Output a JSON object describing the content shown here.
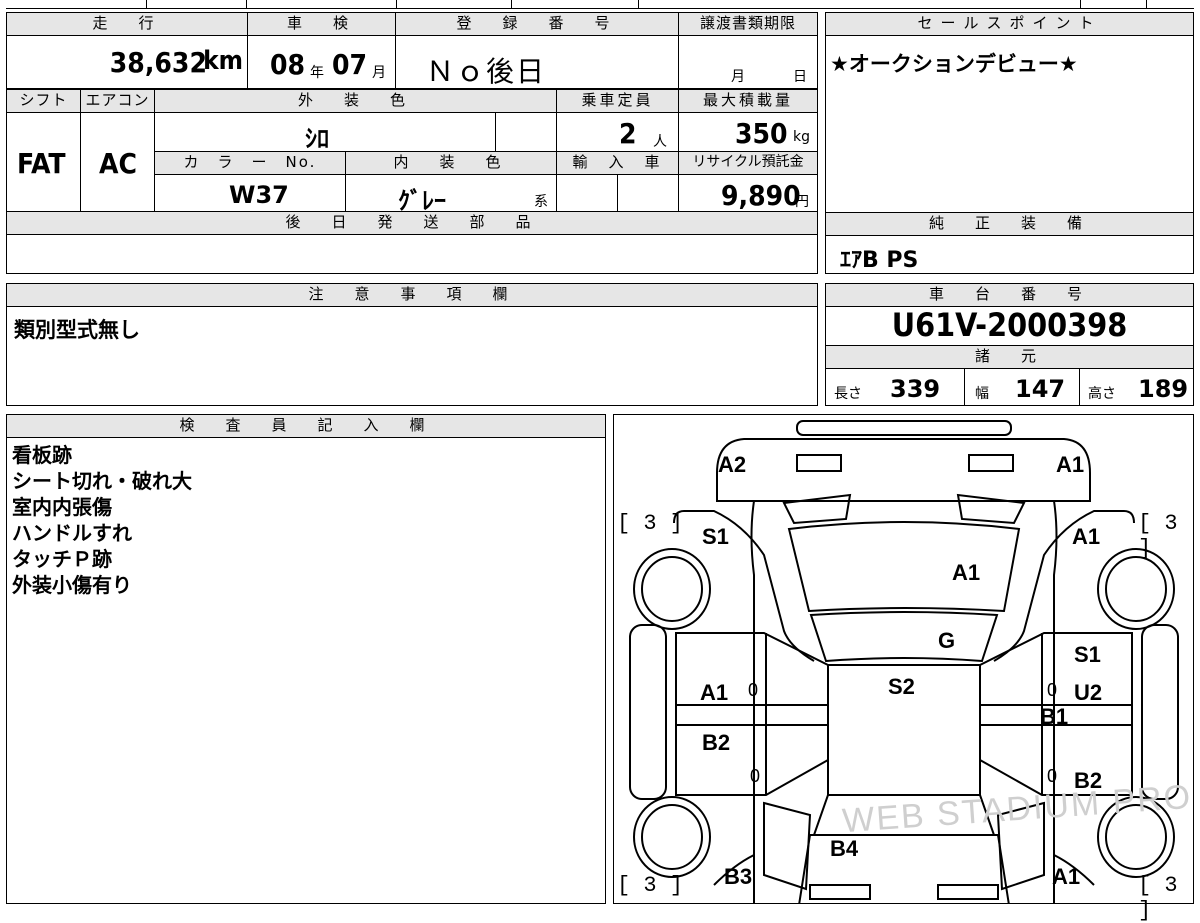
{
  "top_table": {
    "headers": {
      "mileage": "走　行",
      "inspection": "車　検",
      "registration": "登　録　番　号",
      "transfer_deadline": "譲渡書類期限",
      "shift": "シフト",
      "aircon": "エアコン",
      "exterior_color": "外　装　色",
      "capacity": "乗車定員",
      "max_load": "最大積載量",
      "color_no": "カ　ラ　ー　No.",
      "interior_color": "内　装　色",
      "import": "輸　入　車",
      "recycle": "リサイクル預託金",
      "later_parts": "後　日　発　送　部　品"
    },
    "mileage_value": "38,632",
    "mileage_unit": "km",
    "inspection_year": "08",
    "year_unit": "年",
    "inspection_month": "07",
    "month_unit": "月",
    "registration_value": "Ｎｏ後日",
    "deadline_month_unit": "月",
    "deadline_day_unit": "日",
    "shift_value": "FAT",
    "aircon_value": "AC",
    "exterior_color_value": "ｼﾛ",
    "capacity_value": "2",
    "capacity_unit": "人",
    "max_load_value": "350",
    "max_load_unit": "kg",
    "color_no_value": "W37",
    "interior_color_value": "ｸﾞﾚｰ",
    "interior_suffix": "系",
    "recycle_value": "9,890",
    "recycle_unit": "円"
  },
  "sales_point": {
    "header": "セールスポイント",
    "text": "★オークションデビュー★"
  },
  "genuine_equipment": {
    "header": "純　正　装　備",
    "text": "ｴｱB PS"
  },
  "remarks": {
    "header": "注　意　事　項　欄",
    "text": "類別型式無し"
  },
  "chassis": {
    "header": "車　台　番　号",
    "number": "U61V-2000398",
    "specs_header": "諸　元",
    "length_label": "長さ",
    "length_value": "339",
    "width_label": "幅",
    "width_value": "147",
    "height_label": "高さ",
    "height_value": "189"
  },
  "inspector": {
    "header": "検　査　員　記　入　欄",
    "lines": [
      "看板跡",
      "シート切れ・破れ大",
      "室内内張傷",
      "ハンドルすれ",
      "タッチＰ跡",
      "外装小傷有り"
    ]
  },
  "diagram": {
    "bracket_tl": "[ 3 ]",
    "bracket_tr": "[ 3 ]",
    "bracket_bl": "[ 3 ]",
    "bracket_br": "[ 3 ]",
    "label_front_left": "A2",
    "label_front_right": "A1",
    "label_fender_left": "S1",
    "label_fender_right": "A1",
    "label_hood": "A1",
    "label_glass": "G",
    "label_roof": "S2",
    "label_right_front_door_top": "S1",
    "label_left_front_door": "A1",
    "label_right_front_door": "U2",
    "label_right_pillar": "B1",
    "label_left_rear_door": "B2",
    "label_right_rear_door": "B2",
    "label_rear": "B4",
    "label_rear_left": "B3",
    "label_rear_right": "A1",
    "zero": "0",
    "watermark": "WEB STADIUM PRO"
  }
}
